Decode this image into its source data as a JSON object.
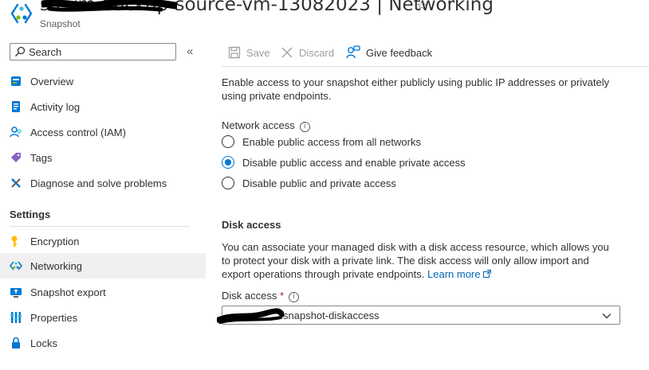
{
  "header": {
    "title": "sa-vm-backup-source-vm-13082023 | Networking",
    "subtitle": "Snapshot",
    "favorite_icon": "star-icon",
    "more_icon": "more-icon"
  },
  "sidebar": {
    "search_placeholder": "Search",
    "collapse_symbol": "«",
    "items": [
      {
        "label": "Overview",
        "icon": "overview-icon"
      },
      {
        "label": "Activity log",
        "icon": "activity-log-icon"
      },
      {
        "label": "Access control (IAM)",
        "icon": "people-icon"
      },
      {
        "label": "Tags",
        "icon": "tag-icon"
      },
      {
        "label": "Diagnose and solve problems",
        "icon": "wrench-icon"
      }
    ],
    "settings_header": "Settings",
    "settings_items": [
      {
        "label": "Encryption",
        "icon": "key-icon"
      },
      {
        "label": "Networking",
        "icon": "networking-icon",
        "selected": true
      },
      {
        "label": "Snapshot export",
        "icon": "export-icon"
      },
      {
        "label": "Properties",
        "icon": "properties-icon"
      },
      {
        "label": "Locks",
        "icon": "lock-icon"
      }
    ]
  },
  "toolbar": {
    "save_label": "Save",
    "discard_label": "Discard",
    "feedback_label": "Give feedback"
  },
  "content": {
    "intro": "Enable access to your snapshot either publicly using public IP addresses or privately using private endpoints.",
    "network_access_label": "Network access",
    "network_options": [
      {
        "label": "Enable public access from all networks",
        "selected": false
      },
      {
        "label": "Disable public access and enable private access",
        "selected": true
      },
      {
        "label": "Disable public and private access",
        "selected": false
      }
    ],
    "disk_access_heading": "Disk access",
    "disk_access_desc": "You can associate your managed disk with a disk access resource, which allows you to protect your disk with a private link. The disk access will only allow import and export operations through private endpoints.",
    "learn_more": "Learn more",
    "disk_access_field_label": "Disk access",
    "required_mark": "*",
    "disk_access_value": "snapshot-diskaccess"
  },
  "colors": {
    "accent": "#0078d4",
    "link": "#0067b8",
    "required": "#a4262c",
    "selected_nav_bg": "#f0f0f0",
    "redaction": "#000000"
  }
}
